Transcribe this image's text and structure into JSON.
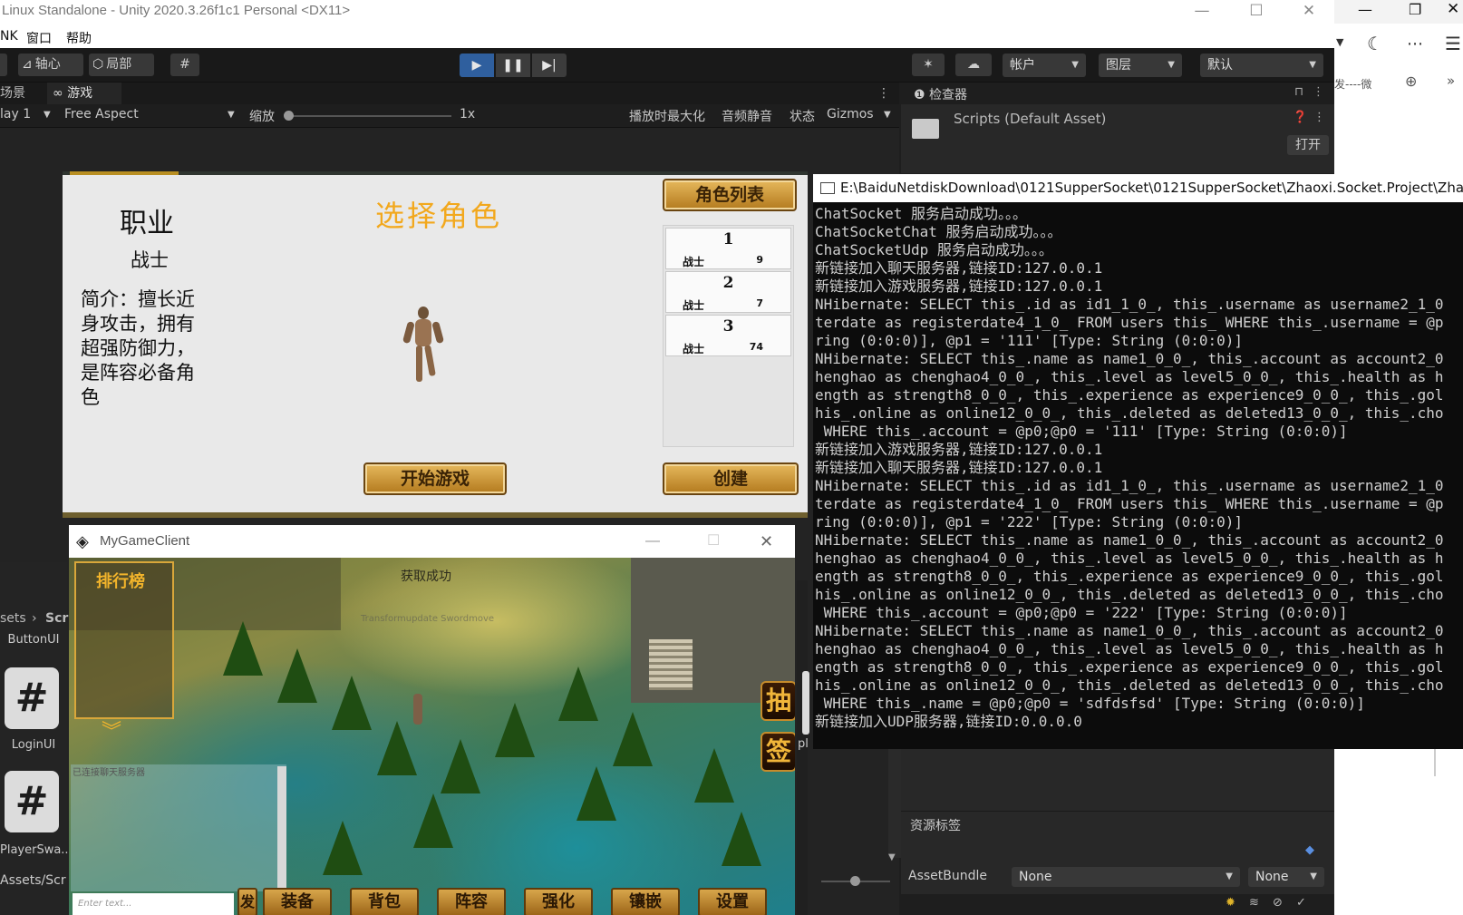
{
  "unity": {
    "window_title": "Linux Standalone - Unity 2020.3.26f1c1 Personal <DX11>",
    "menu": [
      "NK",
      "窗口",
      "帮助"
    ],
    "toolbar": {
      "pivot": "轴心",
      "local": "局部",
      "account": "帐户",
      "layers": "图层",
      "layout": "默认"
    },
    "tabs": {
      "scene": "场景",
      "game": "游戏"
    },
    "game_toolbar": {
      "display": "lay 1",
      "aspect": "Free Aspect",
      "scale_label": "缩放",
      "scale_value": "1x",
      "maximize_on_play": "播放时最大化",
      "mute_audio": "音频静音",
      "stats": "状态",
      "gizmos": "Gizmos"
    },
    "inspector": {
      "tab": "检查器",
      "asset": "Scripts (Default Asset)",
      "open": "打开"
    },
    "lower_right": {
      "asset_labels": "资源标签",
      "assetbundle": "AssetBundle",
      "bundle_value": "None",
      "variant_value": "None"
    },
    "project": {
      "breadcrumb_sets": "sets",
      "breadcrumb_scri": "Scri",
      "items": [
        "ButtonUI",
        "LoginUI",
        "PlayerSwa..."
      ],
      "path": "Assets/Scr",
      "cut_label": "pl"
    }
  },
  "character_select": {
    "class_heading": "职业",
    "class_name": "战士",
    "description": "简介：擅长近身攻击，拥有超强防御力，是阵容必备角色",
    "title": "选择角色",
    "role_list_title": "角色列表",
    "roles": [
      {
        "name": "1",
        "class": "战士",
        "level": "9"
      },
      {
        "name": "2",
        "class": "战士",
        "level": "7"
      },
      {
        "name": "3",
        "class": "战士",
        "level": "74"
      }
    ],
    "start_button": "开始游戏",
    "create_button": "创建"
  },
  "console": {
    "title": "E:\\BaiduNetdiskDownload\\0121SupperSocket\\0121SupperSocket\\Zhaoxi.Socket.Project\\Zhao",
    "lines": [
      "ChatSocket 服务启动成功。。。",
      "ChatSocketChat 服务启动成功。。。",
      "ChatSocketUdp 服务启动成功。。。",
      "新链接加入聊天服务器,链接ID:127.0.0.1",
      "新链接加入游戏服务器,链接ID:127.0.0.1",
      "NHibernate: SELECT this_.id as id1_1_0_, this_.username as username2_1_0",
      "terdate as registerdate4_1_0_ FROM users this_ WHERE this_.username = @p",
      "ring (0:0:0)], @p1 = '111' [Type: String (0:0:0)]",
      "NHibernate: SELECT this_.name as name1_0_0_, this_.account as account2_0",
      "henghao as chenghao4_0_0_, this_.level as level5_0_0_, this_.health as h",
      "ength as strength8_0_0_, this_.experience as experience9_0_0_, this_.gol",
      "his_.online as online12_0_0_, this_.deleted as deleted13_0_0_, this_.cho",
      " WHERE this_.account = @p0;@p0 = '111' [Type: String (0:0:0)]",
      "新链接加入游戏服务器,链接ID:127.0.0.1",
      "新链接加入聊天服务器,链接ID:127.0.0.1",
      "NHibernate: SELECT this_.id as id1_1_0_, this_.username as username2_1_0",
      "terdate as registerdate4_1_0_ FROM users this_ WHERE this_.username = @p",
      "ring (0:0:0)], @p1 = '222' [Type: String (0:0:0)]",
      "NHibernate: SELECT this_.name as name1_0_0_, this_.account as account2_0",
      "henghao as chenghao4_0_0_, this_.level as level5_0_0_, this_.health as h",
      "ength as strength8_0_0_, this_.experience as experience9_0_0_, this_.gol",
      "his_.online as online12_0_0_, this_.deleted as deleted13_0_0_, this_.cho",
      " WHERE this_.account = @p0;@p0 = '222' [Type: String (0:0:0)]",
      "NHibernate: SELECT this_.name as name1_0_0_, this_.account as account2_0",
      "henghao as chenghao4_0_0_, this_.level as level5_0_0_, this_.health as h",
      "ength as strength8_0_0_, this_.experience as experience9_0_0_, this_.gol",
      "his_.online as online12_0_0_, this_.deleted as deleted13_0_0_, this_.cho",
      " WHERE this_.name = @p0;@p0 = 'sdfdsfsd' [Type: String (0:0:0)]",
      "新链接加入UDP服务器,链接ID:0.0.0.0"
    ]
  },
  "client": {
    "window_title": "MyGameClient",
    "leaderboard": "排行榜",
    "toast": "获取成功",
    "debug_text": "Transformupdate  Swordmove",
    "chat_status": "已连接聊天服务器",
    "input_placeholder": "Enter text...",
    "send_label": "发",
    "side_buttons": [
      "抽",
      "签"
    ],
    "bottom_buttons": [
      "装备",
      "背包",
      "阵容",
      "强化",
      "镶嵌",
      "设置"
    ]
  },
  "edge": {
    "tab_text": "发----微"
  },
  "colors": {
    "unity_dark": "#1e1e1e",
    "play_blue": "#2f5f9e",
    "gold": "#f2a81d",
    "console_bg": "#0c0c0c"
  }
}
